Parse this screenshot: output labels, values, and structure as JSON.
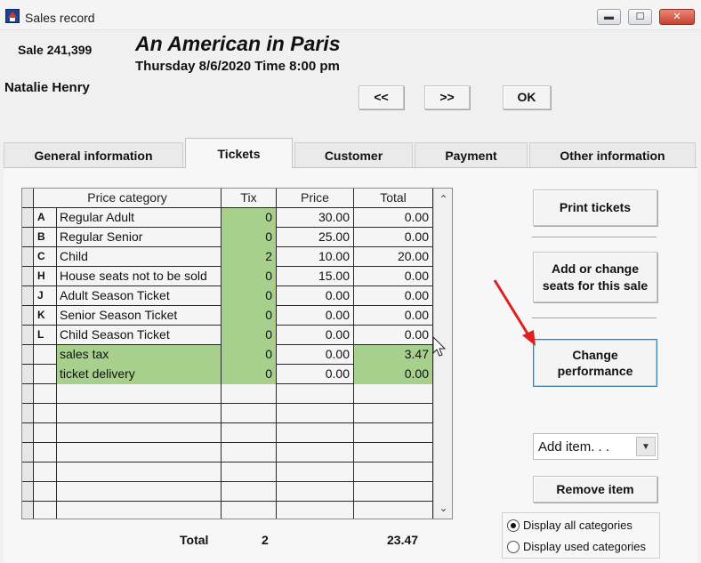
{
  "window": {
    "title": "Sales record",
    "minimize_glyph": "▬",
    "maximize_glyph": "☐",
    "close_glyph": "✕"
  },
  "header": {
    "sale_id": "Sale 241,399",
    "show_title": "An American in Paris",
    "show_datetime": "Thursday 8/6/2020  Time 8:00 pm",
    "customer_name": "Natalie Henry"
  },
  "nav": {
    "prev_label": "<<",
    "next_label": ">>",
    "ok_label": "OK"
  },
  "tabs": [
    {
      "label": "General information"
    },
    {
      "label": "Tickets"
    },
    {
      "label": "Customer"
    },
    {
      "label": "Payment"
    },
    {
      "label": "Other information"
    }
  ],
  "grid": {
    "columns": [
      "Price category",
      "Tix",
      "Price",
      "Total"
    ],
    "rows": [
      {
        "code": "A",
        "category": "Regular Adult",
        "tix": "0",
        "price": "30.00",
        "total": "0.00"
      },
      {
        "code": "B",
        "category": "Regular Senior",
        "tix": "0",
        "price": "25.00",
        "total": "0.00"
      },
      {
        "code": "C",
        "category": "Child",
        "tix": "2",
        "price": "10.00",
        "total": "20.00"
      },
      {
        "code": "H",
        "category": "House seats not to be sold",
        "tix": "0",
        "price": "15.00",
        "total": "0.00"
      },
      {
        "code": "J",
        "category": "Adult Season Ticket",
        "tix": "0",
        "price": "0.00",
        "total": "0.00"
      },
      {
        "code": "K",
        "category": "Senior Season Ticket",
        "tix": "0",
        "price": "0.00",
        "total": "0.00"
      },
      {
        "code": "L",
        "category": "Child Season Ticket",
        "tix": "0",
        "price": "0.00",
        "total": "0.00"
      },
      {
        "code": "",
        "category": "sales tax",
        "tix": "0",
        "price": "0.00",
        "total": "3.47"
      },
      {
        "code": "",
        "category": "ticket delivery",
        "tix": "0",
        "price": "0.00",
        "total": "0.00"
      }
    ],
    "scroll_up_glyph": "⌃",
    "scroll_down_glyph": "⌄"
  },
  "totals": {
    "label": "Total",
    "tix": "2",
    "total": "23.47"
  },
  "actions": {
    "print_tickets": "Print tickets",
    "add_change_seats": "Add or change seats for this sale",
    "change_performance": "Change performance",
    "add_item": "Add item. . .",
    "remove_item": "Remove item"
  },
  "display_options": {
    "all": "Display all categories",
    "used": "Display used categories",
    "selected": "all"
  },
  "colors": {
    "editable_cell": "#a8d08d",
    "annotation_arrow": "#e02020"
  }
}
